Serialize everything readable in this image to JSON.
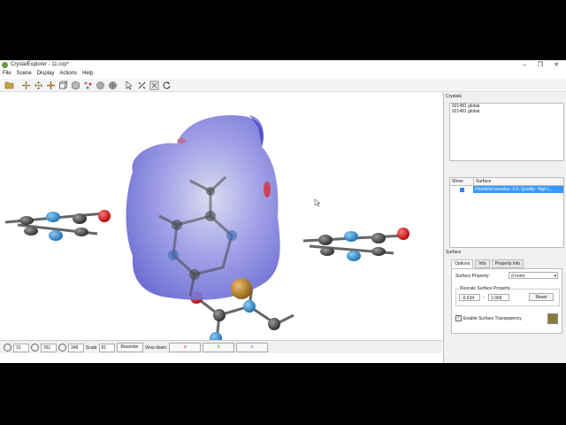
{
  "window": {
    "title": "CrystalExplorer - 11.cxp*",
    "controls": [
      "–",
      "❐",
      "✕"
    ]
  },
  "menu": [
    "File",
    "Scene",
    "Display",
    "Actions",
    "Help"
  ],
  "toolbar_icons": [
    "open-folder-icon",
    "pointer-move-icon",
    "translate-icon",
    "rotate-icon",
    "cell-icon",
    "cube-icon",
    "atoms-icon",
    "sphere-icon",
    "sphere-grid-icon",
    "select-arrow-icon",
    "measure-icon",
    "fragment-icon",
    "reset-icon"
  ],
  "statusbar": {
    "rot_x": "31",
    "rot_y": "261",
    "rot_z": "348",
    "scale_label": "Scale",
    "scale_value": "81",
    "recenter_label": "Recenter",
    "view_down_label": "View down:",
    "view_a": "a",
    "view_b": "b",
    "view_c": "c"
  },
  "crystals": {
    "label": "Crystals",
    "items": [
      "921481 global",
      "921481 global"
    ]
  },
  "surfaces": {
    "col_show": "Show",
    "col_surface": "Surface",
    "row_desc": "Hirshfeld Isovalue: 0.5, Quality: High (..."
  },
  "surface_panel": {
    "label": "Surface",
    "tabs": [
      "Options",
      "Info",
      "Property Info"
    ],
    "property_label": "Surface Property:",
    "property_value": "d norm",
    "range_legend": "Rescale Surface Property",
    "range_min": "-0.634",
    "range_sep": "-",
    "range_max": "1.066",
    "reset_label": "Reset",
    "transparency_label": "Enable Surface Transparency",
    "transparency_checked": "✓"
  },
  "colors": {
    "surface_blue": "#5a5ad8",
    "carbon": "#4a4a4a",
    "nitrogen": "#2a8fd6",
    "oxygen": "#e01010",
    "bromine": "#b07a2a",
    "selection": "#3399ff"
  }
}
